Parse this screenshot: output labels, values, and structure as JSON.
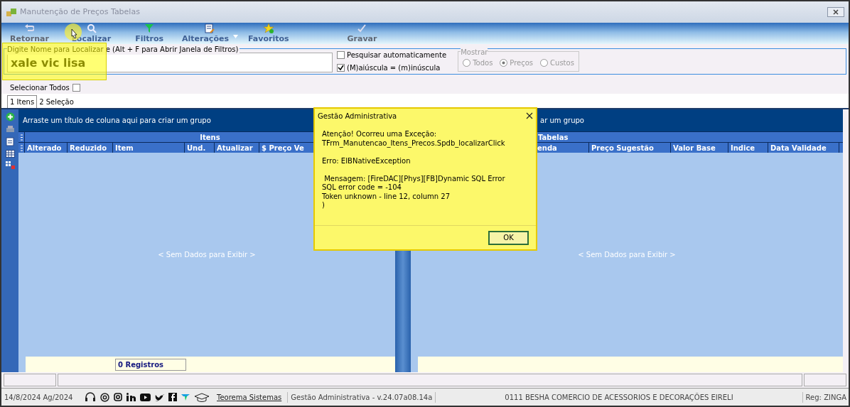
{
  "window": {
    "title": "Manutenção de Preços Tabelas"
  },
  "toolbar": [
    {
      "label": "Retornar",
      "kind": "undo",
      "disabled": true
    },
    {
      "label": "Localizar",
      "kind": "search",
      "disabled": false
    },
    {
      "label": "Filtros",
      "kind": "filter",
      "disabled": false
    },
    {
      "label": "Alterações",
      "kind": "edit",
      "disabled": false,
      "dropdown": true
    },
    {
      "label": "Favoritos",
      "kind": "star",
      "disabled": false
    },
    {
      "label": "Gravar",
      "kind": "check",
      "disabled": true
    }
  ],
  "search": {
    "label": "Digite Nome para Localizar e (Alt + F para Abrir Janela de Filtros)",
    "value": "xale vic lisa"
  },
  "options": [
    {
      "label": "Pesquisar automaticamente",
      "checked": false
    },
    {
      "label": "(M)aiúscula = (m)inúscula",
      "checked": true
    }
  ],
  "show": {
    "title": "Mostrar",
    "options": [
      {
        "label": "Todos",
        "selected": false
      },
      {
        "label": "Preços",
        "selected": true
      },
      {
        "label": "Custos",
        "selected": false
      }
    ]
  },
  "select_all": {
    "label": "Selecionar Todos",
    "checked": false
  },
  "tabs": [
    {
      "label": "1 Itens",
      "selected": true
    },
    {
      "label": "2 Seleção",
      "selected": false
    }
  ],
  "left_grid": {
    "group_hint": "Arraste um título de coluna aqui para criar um grupo",
    "band": "Itens",
    "columns": [
      "Alterado",
      "Reduzido",
      "Item",
      "Und.",
      "Atualizar",
      "$ Preço Ve"
    ],
    "empty_text": "< Sem Dados para Exibir >",
    "footer": "0 Registros"
  },
  "right_grid": {
    "group_hint": "ar um grupo",
    "band": "Tabelas",
    "columns": [
      "enda",
      "Preço Sugestão",
      "Valor Base",
      "Indice",
      "Data Validade"
    ],
    "empty_text": "< Sem Dados para Exibir >"
  },
  "dialog": {
    "title": "Gestão Administrativa",
    "paragraphs": [
      [
        "Atenção! Ocorreu uma Exceção:",
        "TFrm_Manutencao_Itens_Precos.Spdb_localizarClick"
      ],
      [
        "Erro: EIBNativeException"
      ],
      [
        " Mensagem: [FireDAC][Phys][FB]Dynamic SQL Error",
        "SQL error code = -104",
        "Token unknown - line 12, column 27",
        ")"
      ]
    ],
    "button": "OK"
  },
  "status_bar": {
    "date": "14/8/2024 Ag/2024",
    "link": "Teorema Sistemas",
    "version": "Gestão Administrativa - v.24.07a08.14a",
    "company": "0111 BESHA COMERCIO DE ACESSORIOS E DECORAÇÕES EIRELI",
    "reg": "Reg: ZINGA"
  }
}
